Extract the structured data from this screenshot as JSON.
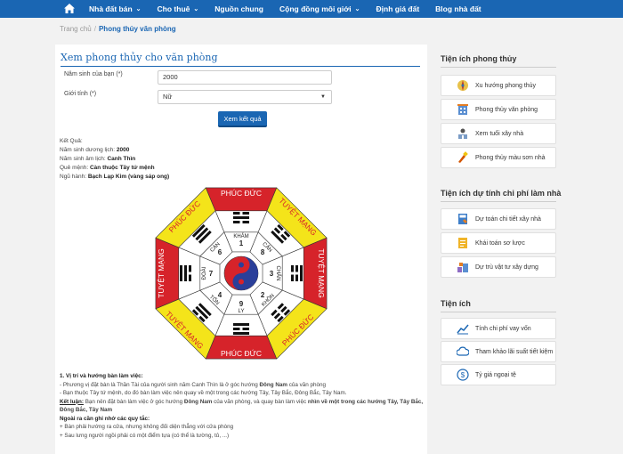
{
  "nav": {
    "items": [
      {
        "label": "Nhà đất bán",
        "dropdown": true
      },
      {
        "label": "Cho thuê",
        "dropdown": true
      },
      {
        "label": "Nguồn chung",
        "dropdown": false
      },
      {
        "label": "Cộng đồng môi giới",
        "dropdown": true
      },
      {
        "label": "Định giá đất",
        "dropdown": false
      },
      {
        "label": "Blog nhà đất",
        "dropdown": false
      }
    ]
  },
  "breadcrumb": {
    "home": "Trang chủ",
    "sep": "/",
    "current": "Phong thủy văn phòng"
  },
  "form": {
    "title": "Xem phong thủy cho văn phòng",
    "year_label": "Năm sinh của bạn (*)",
    "year_value": "2000",
    "gender_label": "Giới tính (*)",
    "gender_value": "Nữ",
    "submit": "Xem kết quả"
  },
  "result": {
    "heading": "Kết Quả:",
    "solar": {
      "label": "Năm sinh dương lịch:",
      "value": "2000"
    },
    "lunar": {
      "label": "Năm sinh âm lịch:",
      "value": "Canh Thìn"
    },
    "cung": {
      "label": "Quẻ mệnh:",
      "value": "Càn thuộc Tây tứ mệnh"
    },
    "element": {
      "label": "Ngũ hành:",
      "value": "Bạch Lạp Kim (vàng sáp ong)"
    }
  },
  "bagua": {
    "outer": [
      "PHÚC ĐỨC",
      "TUYỆT MẠNG",
      "TUYỆT MẠNG",
      "PHÚC ĐỨC",
      "PHÚC ĐỨC",
      "TUYỆT MẠNG",
      "TUYỆT MẠNG",
      "PHÚC ĐỨC"
    ],
    "outer_colors": [
      "#d6232a",
      "#f4e41a",
      "#d6232a",
      "#f4e41a",
      "#d6232a",
      "#f4e41a",
      "#d6232a",
      "#f4e41a"
    ],
    "inner": [
      "KHẢM",
      "CẤN",
      "CHẤN",
      "KHÔN",
      "LY",
      "TỐN",
      "ĐOÀI",
      "CÀN"
    ],
    "numbers": [
      "1",
      "8",
      "3",
      "2",
      "9",
      "4",
      "7",
      "6"
    ],
    "trigrams": [
      [
        0,
        1,
        0
      ],
      [
        0,
        0,
        1
      ],
      [
        1,
        0,
        0
      ],
      [
        0,
        0,
        0
      ],
      [
        1,
        0,
        1
      ],
      [
        0,
        1,
        1
      ],
      [
        1,
        1,
        0
      ],
      [
        1,
        1,
        1
      ]
    ]
  },
  "notes": {
    "h1": "1. Vị trí và hướng bàn làm việc:",
    "l1": "- Phương vị đặt bàn là Thần Tài của người sinh năm Canh Thìn là ở góc hướng",
    "l1b": "Đông Nam",
    "l1c": "của văn phòng",
    "l2": "- Bạn thuộc Tây tứ mệnh, do đó bàn làm việc nên quay về một trong các hướng Tây, Tây Bắc, Đông Bắc, Tây Nam.",
    "k": "Kết luận:",
    "k1": "Bạn nên đặt bàn làm việc ở góc hướng",
    "k1b": "Đông Nam",
    "k1c": "của văn phòng, và quay bàn làm việc",
    "k1d": "nhìn về một trong các hướng Tây, Tây Bắc, Đông Bắc, Tây Nam",
    "h2": "Ngoài ra cần ghi nhớ các quy tắc:",
    "r1": "+ Bàn phải hướng ra cửa, nhưng không đối diện thẳng với cửa phòng",
    "r2": "+ Sau lưng người ngồi phải có một điểm tựa (có thể là tường, tủ, ...)"
  },
  "sidebar": {
    "sec1": "Tiện ích phong thủy",
    "items1": [
      "Xu hướng phong thủy",
      "Phong thủy văn phòng",
      "Xem tuổi xây nhà",
      "Phong thủy màu sơn nhà"
    ],
    "sec2": "Tiện ích dự tính chi phí làm nhà",
    "items2": [
      "Dự toán chi tiết xây nhà",
      "Khái toán sơ lược",
      "Dự trù vật tư xây dựng"
    ],
    "sec3": "Tiện ích",
    "items3": [
      "Tính chi phí vay vốn",
      "Tham khảo lãi suất tiết kiệm",
      "Tỷ giá ngoại tệ"
    ]
  }
}
